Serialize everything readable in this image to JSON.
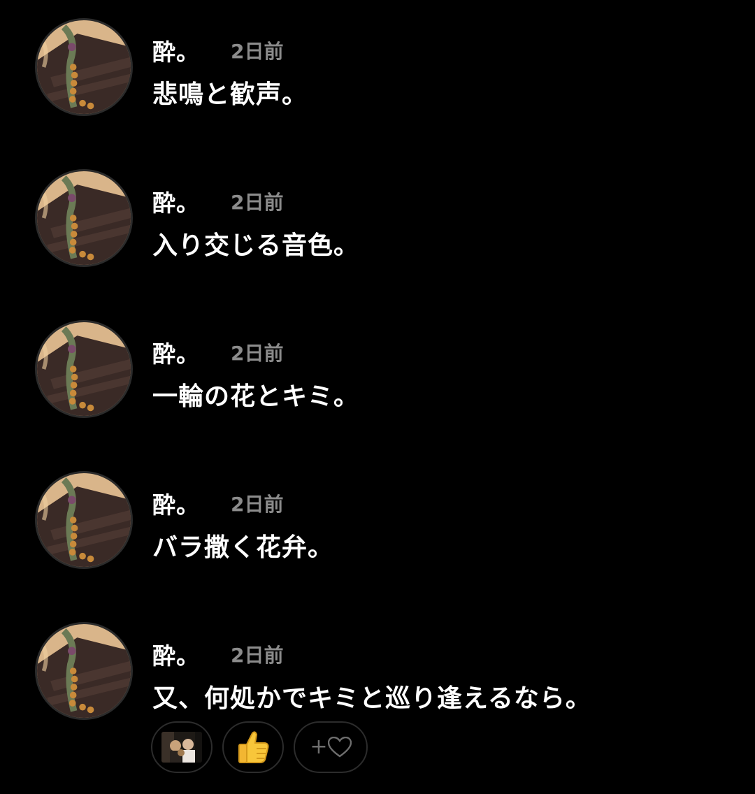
{
  "messages": [
    {
      "author": "酔。",
      "time": "2日前",
      "text": "悲鳴と歓声。"
    },
    {
      "author": "酔。",
      "time": "2日前",
      "text": "入り交じる音色。"
    },
    {
      "author": "酔。",
      "time": "2日前",
      "text": "一輪の花とキミ。"
    },
    {
      "author": "酔。",
      "time": "2日前",
      "text": "バラ撒く花弁。"
    },
    {
      "author": "酔。",
      "time": "2日前",
      "text": "又、何処かでキミと巡り逢えるなら。"
    }
  ],
  "reactions": {
    "photo_icon": "photo-reaction-icon",
    "thumbs_icon": "thumbs-up-icon",
    "add_icon": "add-reaction-heart-icon",
    "add_plus": "+"
  },
  "colors": {
    "background": "#000000",
    "text": "#ffffff",
    "time": "#8b8b8b",
    "chip_border": "#2c2c2c"
  }
}
